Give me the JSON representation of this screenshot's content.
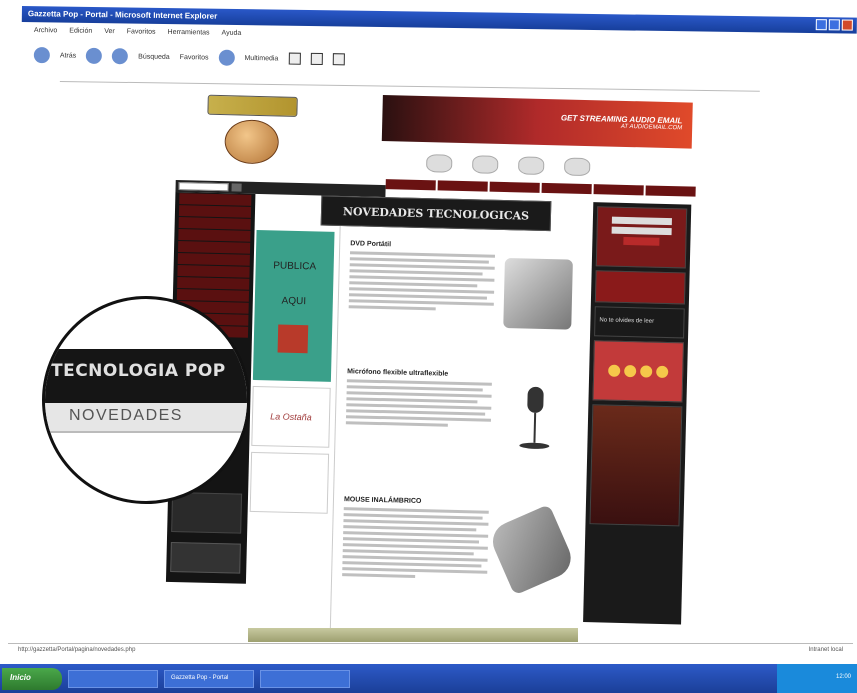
{
  "window": {
    "title": "Gazzetta Pop - Portal - Microsoft Internet Explorer"
  },
  "menubar": [
    "Archivo",
    "Edición",
    "Ver",
    "Favoritos",
    "Herramientas",
    "Ayuda"
  ],
  "toolbar": {
    "back_label": "Atrás",
    "search_label": "Búsqueda",
    "favorites_label": "Favoritos",
    "multimedia_label": "Multimedia"
  },
  "page": {
    "banner_text": "GET STREAMING AUDIO EMAIL",
    "banner_sub": "AT AUDIOEMAIL.COM",
    "headline": "NOVEDADES TECNOLOGICAS",
    "ad_publica": "PUBLICA",
    "ad_aqui": "AQUI",
    "ad_card": "La Ostaña",
    "articles": [
      {
        "title": "DVD Portátil"
      },
      {
        "title": "Micrófono flexible ultraflexible"
      },
      {
        "title": "MOUSE INALÁMBRICO"
      }
    ],
    "right_text": "No te olvides de leer"
  },
  "magnifier": {
    "line1": "TECNOLOGIA POP",
    "line2": "NOVEDADES"
  },
  "statusbar": {
    "left": "http://gazzetta/Portal/pagina/novedades.php",
    "right": "Intranet local"
  },
  "taskbar": {
    "start": "Inicio",
    "tasks": [
      "Gazzetta Pop - Portal"
    ],
    "clock": "12:00"
  },
  "colors": {
    "accent_dark": "#141414",
    "accent_red": "#6a1212",
    "taskbar_blue": "#1b3f98"
  }
}
